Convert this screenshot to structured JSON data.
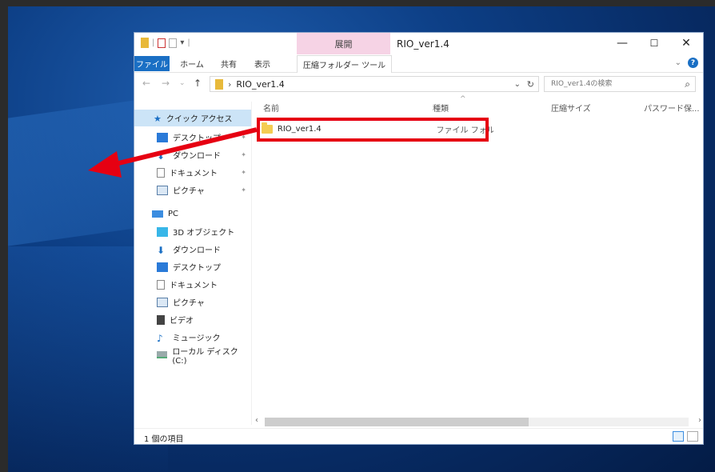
{
  "window": {
    "title": "RIO_ver1.4",
    "contextual_tab": "展開",
    "minimize": "—",
    "maximize": "☐",
    "close": "✕"
  },
  "ribbon": {
    "tabs": [
      {
        "label": "ファイル"
      },
      {
        "label": "ホーム"
      },
      {
        "label": "共有"
      },
      {
        "label": "表示"
      },
      {
        "label": "圧縮フォルダー ツール"
      }
    ],
    "collapse": "⌄",
    "help": "?"
  },
  "address": {
    "back": "←",
    "forward": "→",
    "recent": "⌄",
    "up": "↑",
    "separator": "›",
    "path": "RIO_ver1.4",
    "dropdown": "⌄",
    "refresh": "↻"
  },
  "search": {
    "placeholder": "RIO_ver1.4の検索",
    "icon": "⌕"
  },
  "navigation": {
    "quick_access": "クイック アクセス",
    "quick_items": [
      {
        "label": "デスクトップ",
        "icon": "desktop-icon"
      },
      {
        "label": "ダウンロード",
        "icon": "download-icon"
      },
      {
        "label": "ドキュメント",
        "icon": "document-icon"
      },
      {
        "label": "ピクチャ",
        "icon": "picture-icon"
      }
    ],
    "pc": "PC",
    "pc_items": [
      {
        "label": "3D オブジェクト",
        "icon": "3d-object-icon"
      },
      {
        "label": "ダウンロード",
        "icon": "download-icon"
      },
      {
        "label": "デスクトップ",
        "icon": "desktop-icon"
      },
      {
        "label": "ドキュメント",
        "icon": "document-icon"
      },
      {
        "label": "ピクチャ",
        "icon": "picture-icon"
      },
      {
        "label": "ビデオ",
        "icon": "video-icon"
      },
      {
        "label": "ミュージック",
        "icon": "music-icon"
      },
      {
        "label": "ローカル ディスク (C:)",
        "icon": "local-disk-icon"
      }
    ]
  },
  "columns": {
    "sort_indicator": "^",
    "name": "名前",
    "type": "種類",
    "compressed_size": "圧縮サイズ",
    "password": "パスワード保..."
  },
  "files": [
    {
      "name": "RIO_ver1.4",
      "type": "ファイル フォルダー"
    }
  ],
  "scrollbar": {
    "left_arrow": "‹",
    "right_arrow": "›"
  },
  "status": {
    "count": "1 個の項目"
  },
  "colors": {
    "highlight": "#e60012",
    "file_tab": "#1a6fc4",
    "contextual_tab": "#f6d3e5",
    "selection": "#cce4f7",
    "folder": "#f4cc52"
  }
}
